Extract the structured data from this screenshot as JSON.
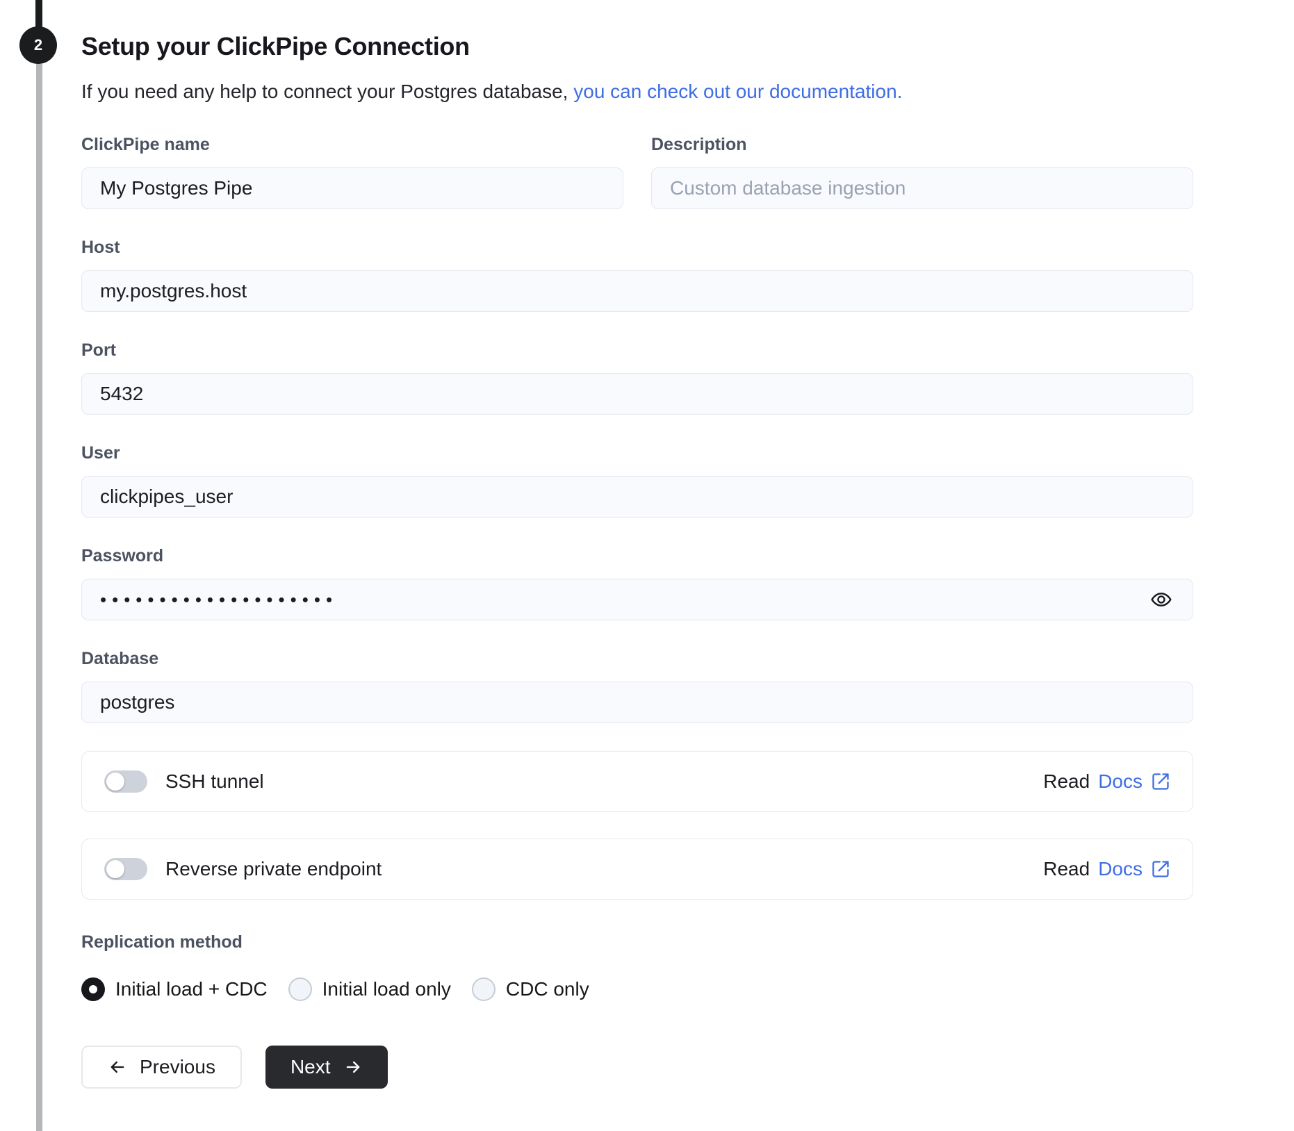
{
  "stepper": {
    "step_number": "2"
  },
  "header": {
    "title": "Setup your ClickPipe Connection",
    "subtitle_text": "If you need any help to connect your Postgres database, ",
    "subtitle_link": "you can check out our documentation."
  },
  "form": {
    "clickpipe_name": {
      "label": "ClickPipe name",
      "value": "My Postgres Pipe"
    },
    "description": {
      "label": "Description",
      "placeholder": "Custom database ingestion"
    },
    "host": {
      "label": "Host",
      "value": "my.postgres.host"
    },
    "port": {
      "label": "Port",
      "value": "5432"
    },
    "user": {
      "label": "User",
      "value": "clickpipes_user"
    },
    "password": {
      "label": "Password",
      "masked_value": "••••••••••••••••••••"
    },
    "database": {
      "label": "Database",
      "value": "postgres"
    },
    "toggles": [
      {
        "label": "SSH tunnel",
        "state": "off",
        "read_label": "Read",
        "docs_label": "Docs"
      },
      {
        "label": "Reverse private endpoint",
        "state": "off",
        "read_label": "Read",
        "docs_label": "Docs"
      }
    ],
    "replication": {
      "label": "Replication method",
      "options": [
        {
          "label": "Initial load + CDC",
          "selected": true
        },
        {
          "label": "Initial load only",
          "selected": false
        },
        {
          "label": "CDC only",
          "selected": false
        }
      ]
    }
  },
  "actions": {
    "previous_label": "Previous",
    "next_label": "Next"
  },
  "colors": {
    "link_blue": "#3e6de4",
    "button_dark": "#292a2e",
    "input_bg": "#f8fafd"
  }
}
